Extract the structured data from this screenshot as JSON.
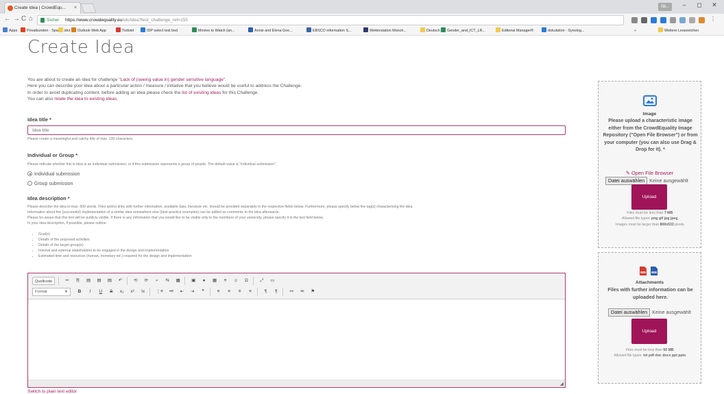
{
  "browser": {
    "tab_title": "Create Idea | CrowdEqu...",
    "tab_close": "×",
    "user_badge": "Sb...",
    "window_controls": [
      "–",
      "◻",
      "✕"
    ],
    "nav": {
      "back": "←",
      "forward": "→",
      "reload": "C",
      "home": "⌂"
    },
    "secure_label": "Sicher",
    "url_host": "https://www.crowdequality.eu",
    "url_path": "/idc/idea?test_challenge_ref=155",
    "bookmarks": [
      "Apps",
      "Privatkunden - Spark...",
      "idct",
      "Outlook Web App",
      "Todoist",
      "IDP select test bed",
      "Movies to Watch (an...",
      "Annie and Elena Goo...",
      "EBSCO information S...",
      "Wetterstation Münch...",
      "Deutsch",
      "Gender_and_ICT_LR...",
      "Editorial Manager®",
      "dokulation - Synolog...",
      "»",
      "Weitere Lesezeichen"
    ]
  },
  "page": {
    "title": "Create Idea",
    "intro": {
      "line1_prefix": "You are about to create an idea for challenge \"",
      "challenge_name": "Lack of (seeing value in) gender sensitive language",
      "line1_suffix": "\".",
      "line2": "Here you can describe your idea about a particular action / measure / initiative that you believe would be useful to address the Challenge.",
      "line3_prefix": "In order to avoid duplicating content, before adding an idea please check the ",
      "line3_link": "list of existing ideas",
      "line3_suffix": " for this Challenge.",
      "line4_prefix": "You can also ",
      "line4_link": "relate the idea to existing ideas",
      "line4_suffix": "."
    },
    "idea_title": {
      "label": "Idea title *",
      "placeholder": "Idea title",
      "help": "Please create a meaningful and catchy title of max. 130 characters."
    },
    "submission_type": {
      "label": "Individual or Group *",
      "help": "Please indicate whether this is idea is an individual submission, or if this submission represents a group of people. The default value is \"individual submission\".",
      "options": [
        "Individual submission",
        "Group submission"
      ],
      "selected": "Individual submission"
    },
    "description": {
      "label": "Idea description *",
      "help_lines": [
        "Please describe the idea in max. 600 words. Files and/or links with further information, available data, literature etc. should be provided separately in the respective fields below. Furthermore, please specify below the tag(s) characterising the idea.",
        "Information about the (successful) implementation of a similar idea somewhere else (best-practice examples) can be added as comments to the idea afterwards.",
        "Please be aware that this text will be publicly visible. If there is any information that you would like to be visible only to the members of your university, please specify it in the text field below.",
        "In your idea description, if possible, please outline:"
      ],
      "outline": [
        "Goal(s)",
        "Details of the proposed activities",
        "Details of the target group(s)",
        "Internal and external stakeholders to be engaged in the design and implementation",
        "Estimated time and resources (human, monetary etc.) required for the design and implementation"
      ]
    },
    "editor": {
      "source_label": "Quellcode",
      "format_label": "Format",
      "row1": [
        "✂",
        "⎘",
        "▤",
        "▤",
        "▤",
        "↶",
        "⟲",
        "⟳",
        "⌕",
        "⇆",
        "▦",
        "▣",
        "●",
        "▦",
        "≡",
        "☺",
        "Ω",
        "⤢",
        "▭"
      ],
      "row2": [
        "B",
        "I",
        "U",
        "S",
        "x₂",
        "x²",
        "Ix",
        "⋮≡",
        "•≡",
        "⇤",
        "⇥",
        "❞",
        "≡",
        "≡",
        "≡",
        "≡",
        "¶",
        "¶",
        "⚯",
        "⚮",
        "⚑"
      ],
      "resize_glyph": "◢"
    },
    "switch_editor": "Switch to plain text editor"
  },
  "image_panel": {
    "title": "Image",
    "text": "Please upload a characteristic image either from the CrowdEquality Image Repository (\"Open File Browser\") or from your computer (you can also use Drag & Drop for it). *",
    "open_browser": "Open File Browser",
    "file_button": "Datei auswählen",
    "file_status": "Keine ausgewählt",
    "upload": "Upload",
    "rule1_prefix": "Files must be less than ",
    "rule1_bold": "7 MB",
    "rule1_suffix": ".",
    "rule2_prefix": "Allowed file types: ",
    "rule2_bold": "png gif jpg jpeg",
    "rule2_suffix": ".",
    "rule3_prefix": "Images must be larger than ",
    "rule3_bold": "800x533",
    "rule3_suffix": " pixels."
  },
  "attachments_panel": {
    "title": "Attachments",
    "text": "Files with further information can be uploaded here.",
    "file_button": "Datei auswählen",
    "file_status": "Keine ausgewählt",
    "upload": "Upload",
    "rule1_prefix": "Files must be less than ",
    "rule1_bold": "50 MB",
    "rule1_suffix": ".",
    "rule2_prefix": "Allowed file types: ",
    "rule2_bold": "txt pdf doc docx ppt pptx",
    "rule2_suffix": "."
  },
  "colors": {
    "accent": "#a0145a",
    "link": "#a01f59",
    "secure": "#2e8b57"
  }
}
